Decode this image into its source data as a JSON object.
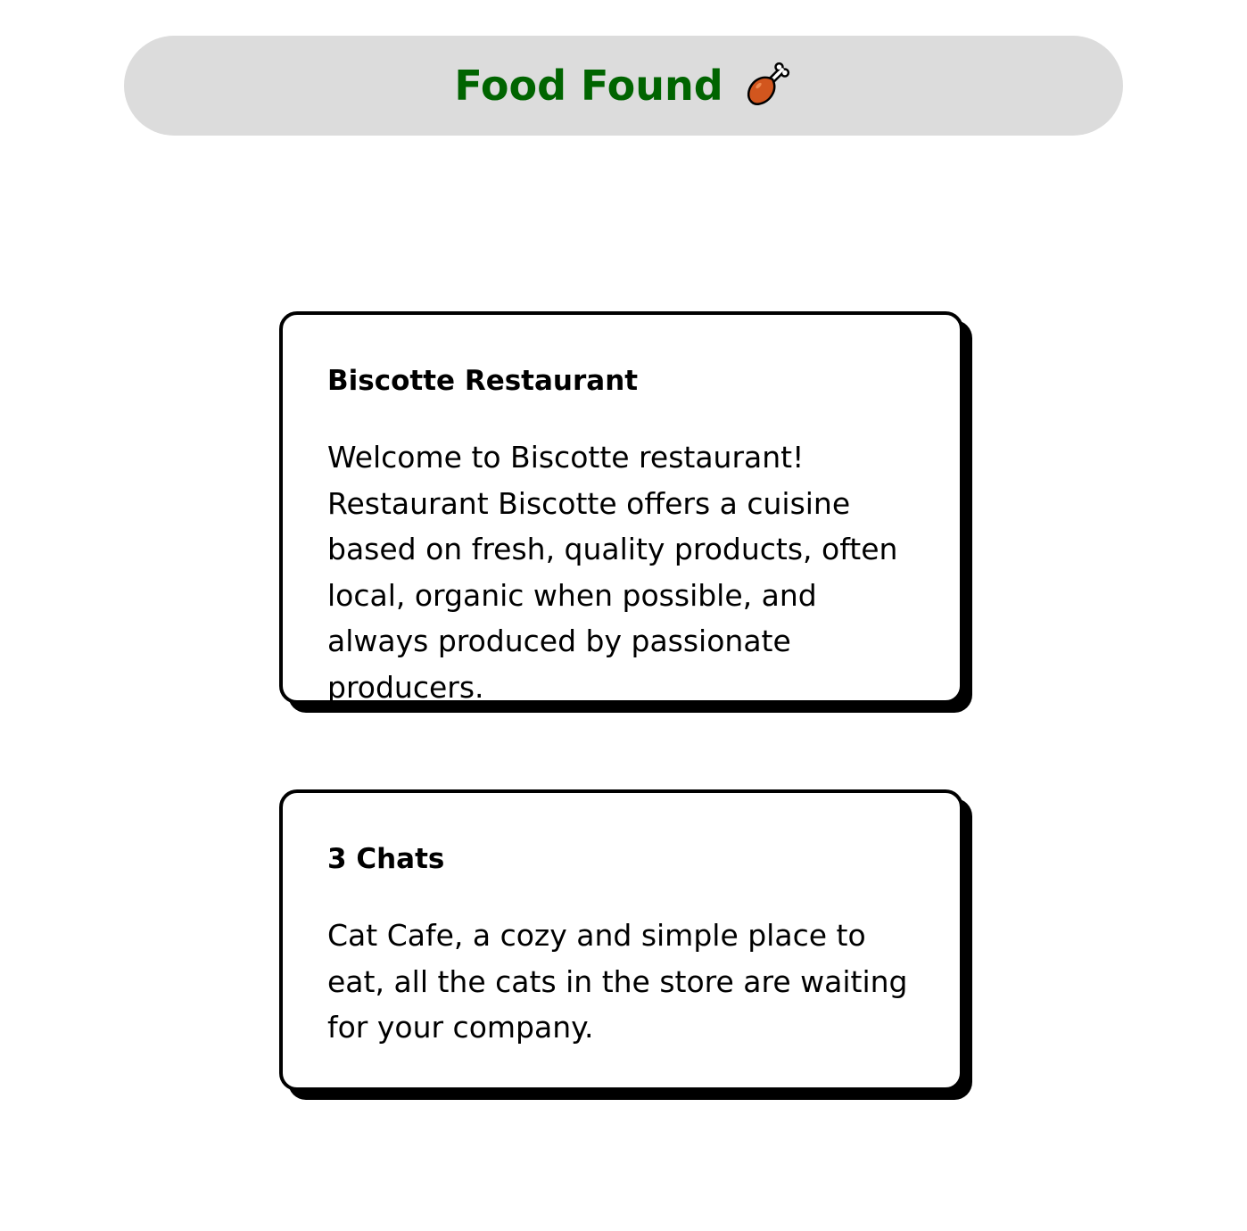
{
  "header": {
    "title": "Food Found",
    "icon": "poultry-leg-icon",
    "background_color": "#dcdcdc",
    "title_color": "#006400"
  },
  "cards": [
    {
      "title": "Biscotte Restaurant",
      "description": "Welcome to Biscotte restaurant! Restaurant Biscotte offers a cuisine based on fresh, quality products, often local, organic when possible, and always produced by passionate producers."
    },
    {
      "title": "3 Chats",
      "description": "Cat Cafe, a cozy and simple place to eat, all the cats in the store are waiting for your company."
    }
  ]
}
